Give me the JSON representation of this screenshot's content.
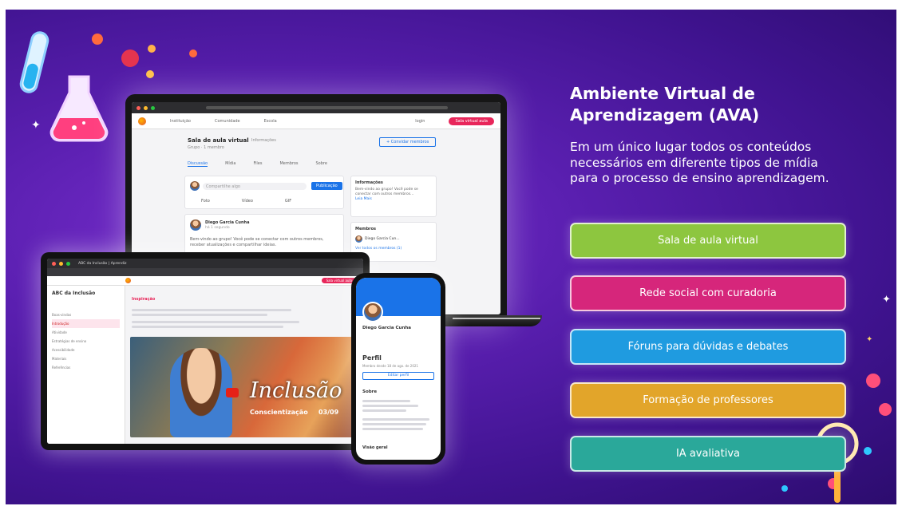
{
  "header": {
    "title_line1": "Ambiente Virtual de",
    "title_line2": "Aprendizagem (AVA)",
    "subtitle": "Em um único lugar todos os conteúdos necessários em diferente tipos de mídia para o processo de ensino aprendizagem."
  },
  "features": [
    {
      "label": "Sala de aula virtual",
      "color": "#8dc63f"
    },
    {
      "label": "Rede social com curadoria",
      "color": "#d6267b"
    },
    {
      "label": "Fóruns para dúvidas e debates",
      "color": "#1f9be0"
    },
    {
      "label": "Formação de professores",
      "color": "#e2a52a"
    },
    {
      "label": "IA avaliativa",
      "color": "#2aa89a"
    }
  ],
  "laptop_screen": {
    "nav_items": [
      "Instituição",
      "Comunidade",
      "Escola"
    ],
    "nav_login": "login",
    "nav_pill": "Sala virtual aula",
    "page_title": "Sala de aula virtual",
    "page_tag": "Informações",
    "page_meta": "Grupo · 1 membro",
    "invite_button": "+ Convidar membros",
    "tabs": [
      "Discussão",
      "Mídia",
      "Files",
      "Membros",
      "Sobre"
    ],
    "compose_placeholder": "Compartilhe algo",
    "compose_button": "Publicação",
    "compose_actions": [
      "Foto",
      "Vídeo",
      "GIF"
    ],
    "post_author": "Diego Garcia Cunha",
    "post_time": "há 1 segundo",
    "post_text": "Bem-vindo ao grupo! Você pode se conectar com outros membros, receber atualizações e compartilhar ideias.",
    "info_title": "Informações",
    "info_text": "Bem-vindo ao grupo! Você pode se conectar com outros membros...",
    "info_link": "Leia Mais",
    "members_title": "Membros",
    "members_name": "Diego Garcia Cun...",
    "members_link": "Ver todos os membros (1)"
  },
  "tablet_screen": {
    "tab_title": "ABC da Inclusão | Aprendiz",
    "sidebar_title": "ABC da Inclusão",
    "sidebar_items": [
      "Boas-vindas",
      "Introdução",
      "Atividade",
      "Estratégias de ensino",
      "Acessibilidade",
      "Materiais",
      "Referências"
    ],
    "section_title": "Inspiração",
    "banner_word": "Inclusão",
    "banner_sub": "Conscientização",
    "banner_date": "03/09"
  },
  "phone_screen": {
    "profile_name": "Diego Garcia Cunha",
    "section": "Perfil",
    "joined": "Membro desde 18 de ago. de 2021",
    "edit_button": "Editar perfil",
    "about_title": "Sobre",
    "footer_label": "Visão geral"
  }
}
